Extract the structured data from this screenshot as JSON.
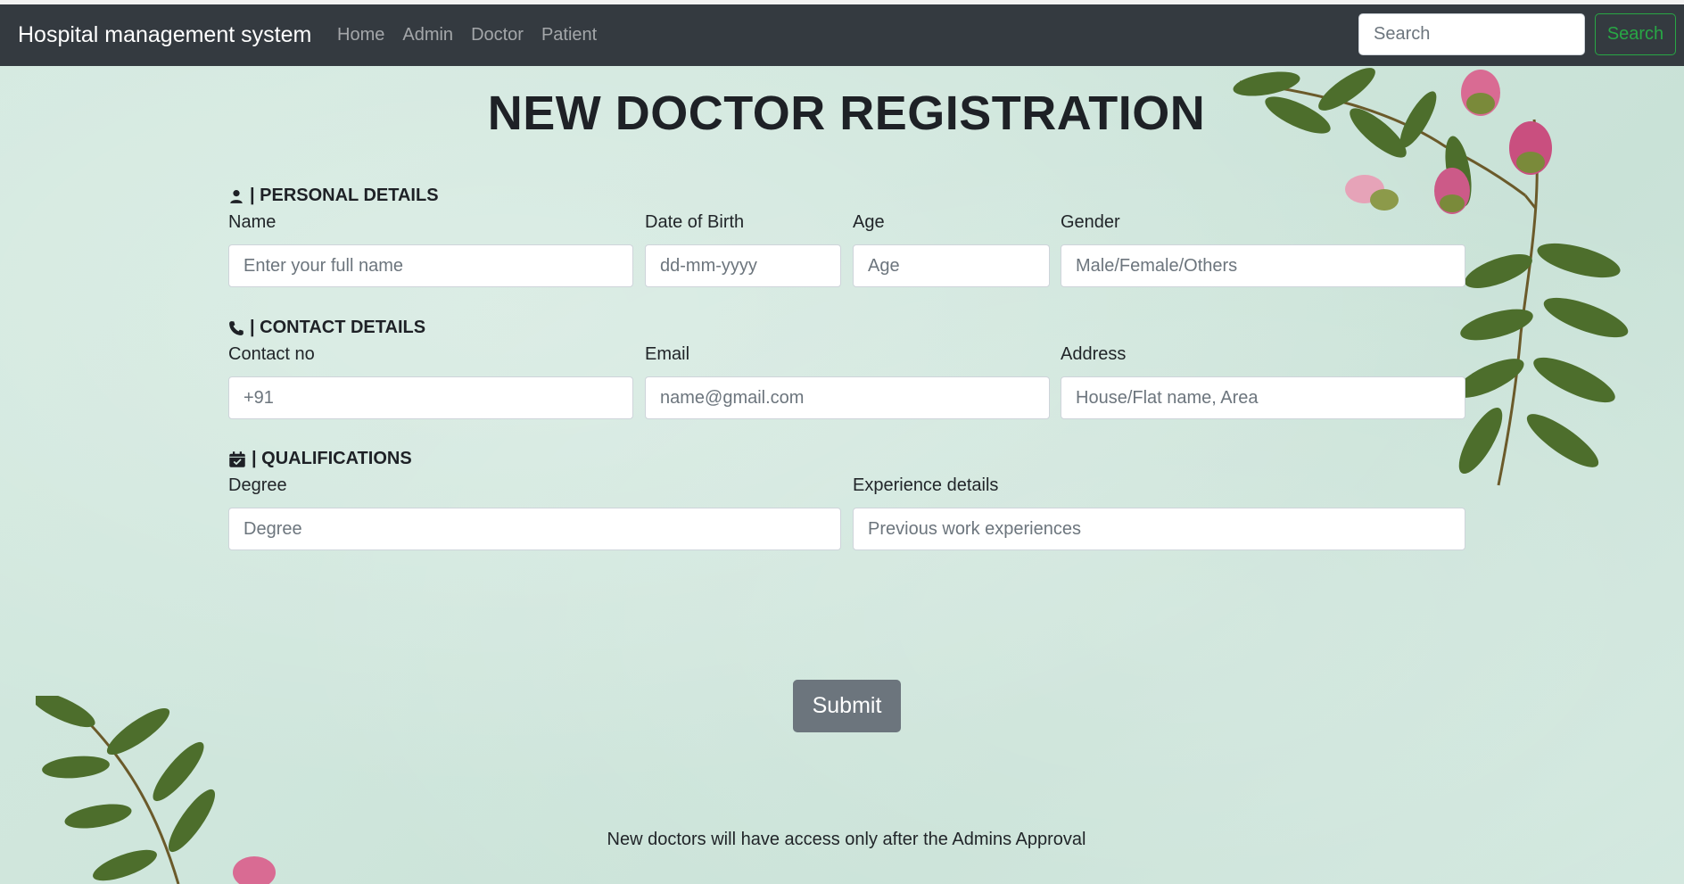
{
  "navbar": {
    "brand": "Hospital management system",
    "links": [
      "Home",
      "Admin",
      "Doctor",
      "Patient"
    ],
    "search_placeholder": "Search",
    "search_button": "Search"
  },
  "page": {
    "title": "NEW DOCTOR REGISTRATION"
  },
  "sections": {
    "personal": {
      "heading": "| PERSONAL DETAILS",
      "icon": "user-icon",
      "fields": {
        "name": {
          "label": "Name",
          "placeholder": "Enter your full name"
        },
        "dob": {
          "label": "Date of Birth",
          "placeholder": "dd-mm-yyyy"
        },
        "age": {
          "label": "Age",
          "placeholder": "Age"
        },
        "gender": {
          "label": "Gender",
          "placeholder": "Male/Female/Others"
        }
      }
    },
    "contact": {
      "heading": "| CONTACT DETAILS",
      "icon": "phone-icon",
      "fields": {
        "contact": {
          "label": "Contact no",
          "placeholder": "+91"
        },
        "email": {
          "label": "Email",
          "placeholder": "name@gmail.com"
        },
        "address": {
          "label": "Address",
          "placeholder": "House/Flat name, Area"
        }
      }
    },
    "qualifications": {
      "heading": "| QUALIFICATIONS",
      "icon": "calendar-check-icon",
      "fields": {
        "degree": {
          "label": "Degree",
          "placeholder": "Degree"
        },
        "experience": {
          "label": "Experience details",
          "placeholder": "Previous work experiences"
        }
      }
    }
  },
  "form": {
    "submit_label": "Submit"
  },
  "footer": {
    "note": "New doctors will have access only after the Admins Approval"
  },
  "colors": {
    "navbar_bg": "#343a40",
    "page_bg": "#cfe6dc",
    "success_green": "#28a745",
    "submit_gray": "#6c757d"
  }
}
